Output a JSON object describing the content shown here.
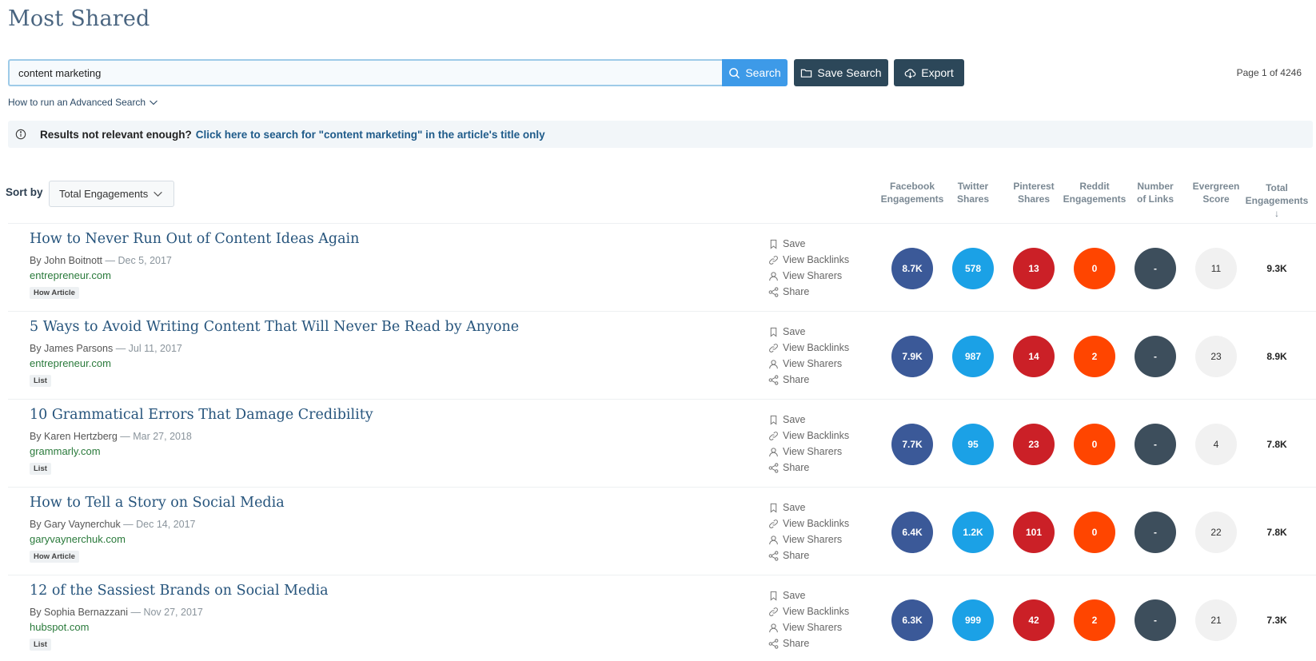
{
  "page": {
    "title": "Most Shared",
    "page_info": "Page 1 of 4246"
  },
  "search": {
    "value": "content marketing",
    "button_label": "Search",
    "save_label": "Save Search",
    "export_label": "Export"
  },
  "advanced_link": "How to run an Advanced Search",
  "notice": {
    "question": "Results not relevant enough?",
    "link": "Click here to search for \"content marketing\" in the article's title only"
  },
  "sort": {
    "label": "Sort by",
    "value": "Total Engagements"
  },
  "columns": [
    {
      "line1": "Facebook",
      "line2": "Engagements"
    },
    {
      "line1": "Twitter",
      "line2": "Shares"
    },
    {
      "line1": "Pinterest",
      "line2": "Shares"
    },
    {
      "line1": "Reddit",
      "line2": "Engagements"
    },
    {
      "line1": "Number",
      "line2": "of Links"
    },
    {
      "line1": "Evergreen",
      "line2": "Score"
    },
    {
      "line1": "Total",
      "line2": "Engagements ↓"
    }
  ],
  "actions": {
    "save": "Save",
    "backlinks": "View Backlinks",
    "sharers": "View Sharers",
    "share": "Share"
  },
  "articles": [
    {
      "title": "How to Never Run Out of Content Ideas Again",
      "author": "By John Boitnott",
      "date": " — Dec 5, 2017",
      "domain": "entrepreneur.com",
      "tag": "How Article",
      "facebook": "8.7K",
      "twitter": "578",
      "pinterest": "13",
      "reddit": "0",
      "links": "-",
      "evergreen": "11",
      "total": "9.3K"
    },
    {
      "title": "5 Ways to Avoid Writing Content That Will Never Be Read by Anyone",
      "author": "By James Parsons",
      "date": " — Jul 11, 2017",
      "domain": "entrepreneur.com",
      "tag": "List",
      "facebook": "7.9K",
      "twitter": "987",
      "pinterest": "14",
      "reddit": "2",
      "links": "-",
      "evergreen": "23",
      "total": "8.9K"
    },
    {
      "title": "10 Grammatical Errors That Damage Credibility",
      "author": "By Karen Hertzberg",
      "date": " — Mar 27, 2018",
      "domain": "grammarly.com",
      "tag": "List",
      "facebook": "7.7K",
      "twitter": "95",
      "pinterest": "23",
      "reddit": "0",
      "links": "-",
      "evergreen": "4",
      "total": "7.8K"
    },
    {
      "title": "How to Tell a Story on Social Media",
      "author": "By Gary Vaynerchuk",
      "date": " — Dec 14, 2017",
      "domain": "garyvaynerchuk.com",
      "tag": "How Article",
      "facebook": "6.4K",
      "twitter": "1.2K",
      "pinterest": "101",
      "reddit": "0",
      "links": "-",
      "evergreen": "22",
      "total": "7.8K"
    },
    {
      "title": "12 of the Sassiest Brands on Social Media",
      "author": "By Sophia Bernazzani",
      "date": " — Nov 27, 2017",
      "domain": "hubspot.com",
      "tag": "List",
      "facebook": "6.3K",
      "twitter": "999",
      "pinterest": "42",
      "reddit": "2",
      "links": "-",
      "evergreen": "21",
      "total": "7.3K"
    }
  ],
  "colors": {
    "facebook": "#3b5998",
    "twitter": "#1ba1e6",
    "pinterest": "#cb2027",
    "reddit": "#ff4500",
    "links": "#3d4e5c",
    "primary": "#3d9ae8",
    "dark": "#2c4759"
  }
}
